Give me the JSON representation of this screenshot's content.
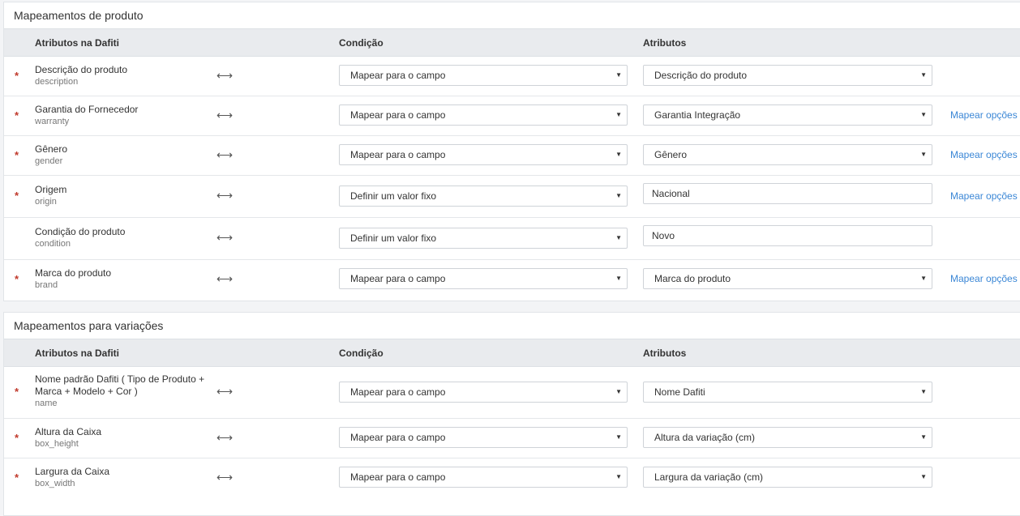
{
  "headers": {
    "attr": "Atributos na Dafiti",
    "cond": "Condição",
    "target": "Atributos"
  },
  "product": {
    "title": "Mapeamentos de produto",
    "rows": [
      {
        "label": "Descrição do produto",
        "key": "description",
        "cond": "Mapear para o campo",
        "target": "Descrição do produto",
        "link": ""
      },
      {
        "label": "Garantia do Fornecedor",
        "key": "warranty",
        "cond": "Mapear para o campo",
        "target": "Garantia Integração",
        "link": "Mapear opções"
      },
      {
        "label": "Gênero",
        "key": "gender",
        "cond": "Mapear para o campo",
        "target": "Gênero",
        "link": "Mapear opções"
      },
      {
        "label": "Origem",
        "key": "origin",
        "cond": "Definir um valor fixo",
        "target": "Nacional",
        "link": "Mapear opções"
      },
      {
        "label": "Condição do produto",
        "key": "condition",
        "cond": "Definir um valor fixo",
        "target": "Novo",
        "link": ""
      },
      {
        "label": "Marca do produto",
        "key": "brand",
        "cond": "Mapear para o campo",
        "target": "Marca do produto",
        "link": "Mapear opções"
      }
    ]
  },
  "variations": {
    "title": "Mapeamentos para variações",
    "rows": [
      {
        "label": "Nome padrão Dafiti ( Tipo de Produto + Marca + Modelo + Cor )",
        "key": "name",
        "cond": "Mapear para o campo",
        "target": "Nome Dafiti",
        "link": ""
      },
      {
        "label": "Altura da Caixa",
        "key": "box_height",
        "cond": "Mapear para o campo",
        "target": "Altura da variação (cm)",
        "link": ""
      },
      {
        "label": "Largura da Caixa",
        "key": "box_width",
        "cond": "Mapear para o campo",
        "target": "Largura da variação (cm)",
        "link": ""
      }
    ]
  },
  "symbols": {
    "required": "*",
    "map_arrow": "⟷",
    "caret": "▼"
  }
}
